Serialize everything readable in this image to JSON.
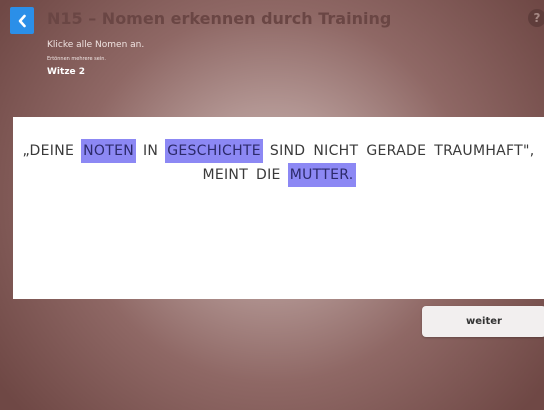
{
  "header": {
    "title": "N15 – Nomen erkennen durch Training",
    "help_glyph": "?"
  },
  "task": {
    "instruction": "Klicke alle Nomen an.",
    "hint": "Ertönnen mehrere sein.",
    "exercise": "Witze 2"
  },
  "sentence": {
    "line1": [
      {
        "text": "„DEINE",
        "selected": false
      },
      {
        "text": "NOTEN",
        "selected": true
      },
      {
        "text": "IN",
        "selected": false
      },
      {
        "text": "GESCHICHTE",
        "selected": true
      },
      {
        "text": "SIND",
        "selected": false
      },
      {
        "text": "NICHT",
        "selected": false
      },
      {
        "text": "GERADE",
        "selected": false
      },
      {
        "text": "TRAUMHAFT\",",
        "selected": false
      }
    ],
    "line2": [
      {
        "text": "MEINT",
        "selected": false
      },
      {
        "text": "DIE",
        "selected": false
      },
      {
        "text": "MUTTER.",
        "selected": true
      }
    ]
  },
  "actions": {
    "next_label": "weiter"
  },
  "colors": {
    "back_button": "#2b8fe8",
    "selection": "#8c88f4",
    "panel": "#ffffff"
  },
  "icons": {
    "back": "chevron-left-icon",
    "help": "help-icon"
  }
}
